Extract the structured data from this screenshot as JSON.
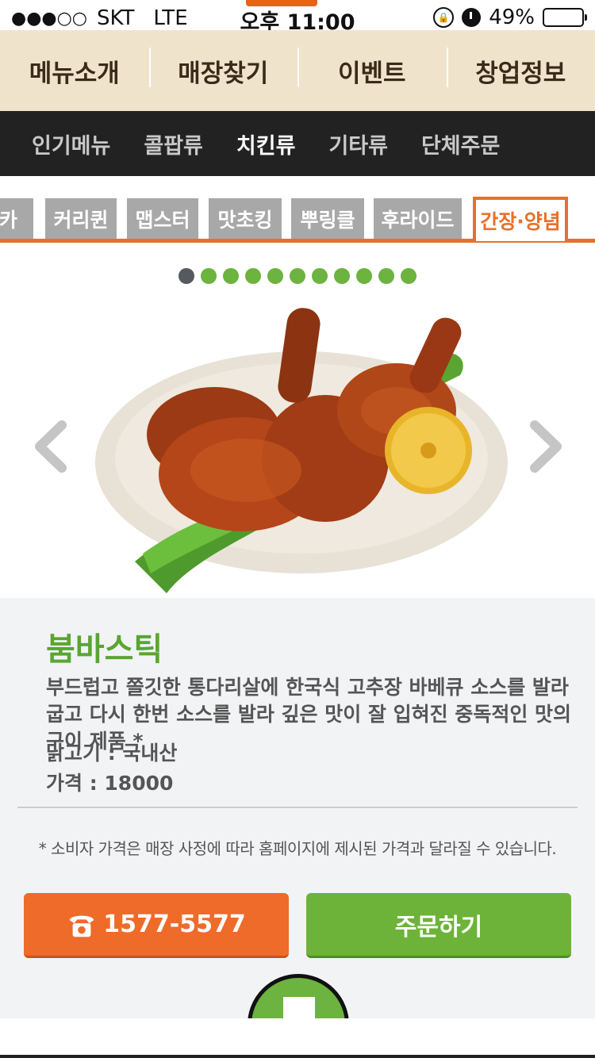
{
  "status_bar": {
    "signal": "●●●○○",
    "carrier": "SKT",
    "network": "LTE",
    "time": "오후 11:00",
    "battery": "49%",
    "battery_level": 0.49
  },
  "top_nav": [
    "메뉴소개",
    "매장찾기",
    "이벤트",
    "창업정보"
  ],
  "categories": {
    "items": [
      "인기메뉴",
      "콜팝류",
      "치킨류",
      "기타류",
      "단체주문"
    ],
    "active_index": 2
  },
  "sub_tabs": {
    "items": [
      "체카",
      "커리퀸",
      "맵스터",
      "맛초킹",
      "뿌링클",
      "후라이드",
      "간장·양념"
    ],
    "active_index": 6
  },
  "carousel": {
    "dot_count": 11,
    "current_index": 0,
    "prev_icon": "chevron-left-icon",
    "next_icon": "chevron-right-icon"
  },
  "product": {
    "name": "붐바스틱",
    "description": "부드럽고 쫄깃한 통다리살에 한국식 고추장 바베큐 소스를 발라 굽고 다시 한번 소스를 발라 깊은 맛이 잘 입혀진 중독적인 맛의 구이 제품 *",
    "origin": "닭고기 : 국내산",
    "price": "가격 : 18000"
  },
  "notice": "* 소비자 가격은 매장 사정에 따라 홈페이지에 제시된 가격과 달라질 수 있습니다.",
  "buttons": {
    "call_number": "1577-5577",
    "call_icon": "phone-icon",
    "order_label": "주문하기"
  },
  "colors": {
    "accent_orange": "#ee6b2a",
    "accent_green": "#6db33a",
    "nav_beige": "#efe3cb",
    "category_bg": "#222222"
  }
}
